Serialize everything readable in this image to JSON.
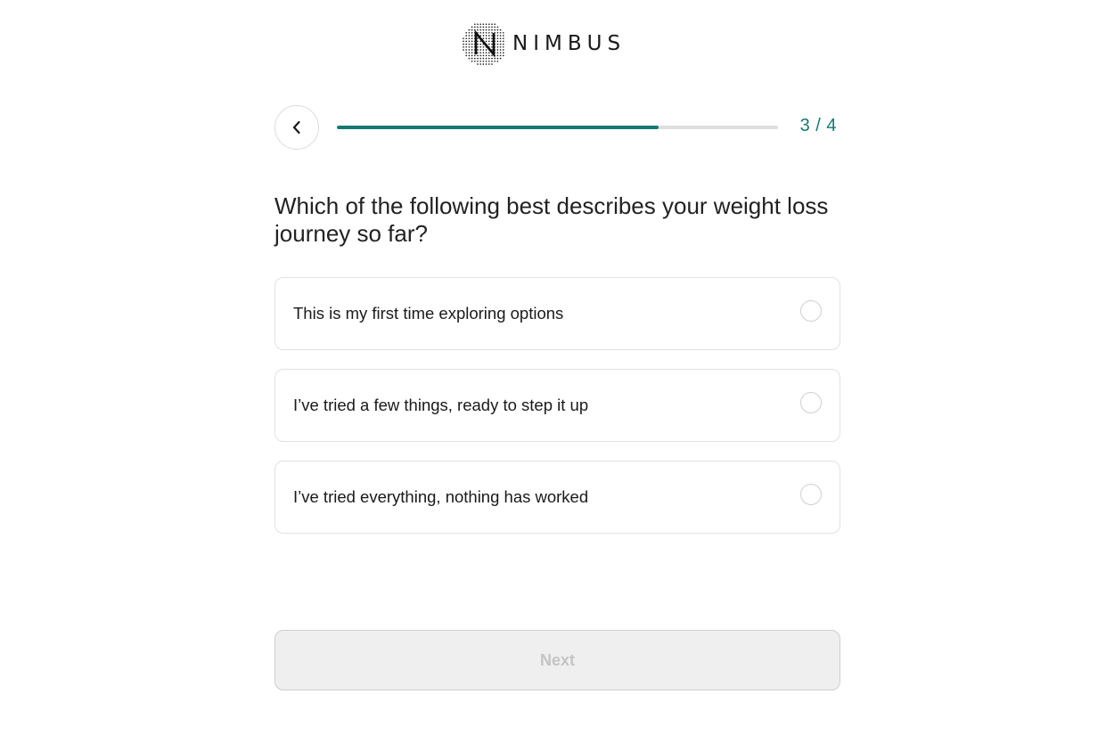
{
  "brand": {
    "name": "NIMBUS",
    "logo_icon": "nimbus-dotted-n-logo"
  },
  "progress": {
    "current_step": 3,
    "total_steps": 4,
    "counter_text": "3 / 4",
    "fill_fraction": 0.73,
    "back_icon": "chevron-left-icon"
  },
  "question": {
    "text": "Which of the following best describes your weight loss journey so far?"
  },
  "options": [
    {
      "label": "This is my first time exploring options",
      "selected": false
    },
    {
      "label": "I’ve tried a few things, ready to step it up",
      "selected": false
    },
    {
      "label": "I’ve tried everything, nothing has worked",
      "selected": false
    }
  ],
  "next_button": {
    "label": "Next",
    "disabled": true
  },
  "colors": {
    "accent": "#137a70",
    "track": "#dedede",
    "border": "#e2e2e2",
    "disabled_bg": "#efefef",
    "disabled_text": "#c4c4c4"
  }
}
